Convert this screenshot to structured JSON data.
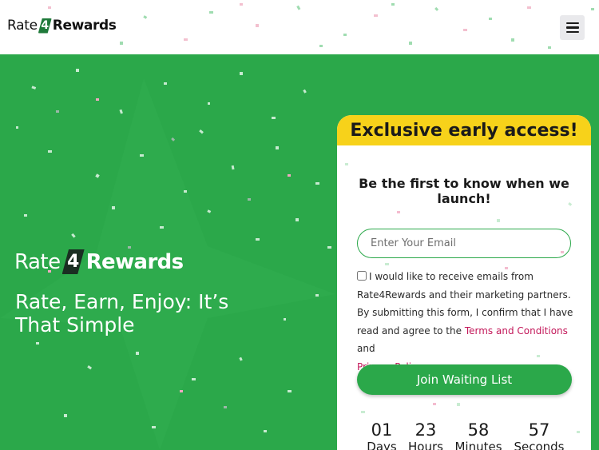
{
  "header": {
    "logo": {
      "word1": "Rate",
      "digit": "4",
      "word2": "Rewards"
    },
    "menu_icon": "hamburger-menu-icon"
  },
  "hero": {
    "logo": {
      "word1": "Rate",
      "digit": "4",
      "word2": "Rewards"
    },
    "tagline": "Rate, Earn, Enjoy: It’s That Simple"
  },
  "signup": {
    "banner": "Exclusive early access!",
    "subheading": "Be the first to know when we launch!",
    "email_placeholder": "Enter Your Email",
    "consent_text": "I would like to receive emails from Rate4Rewards and their marketing partners. By submitting this form, I confirm that I have read and agree to the",
    "terms_link": "Terms and Conditions",
    "and_text": "and",
    "privacy_link": "Privacy Policy",
    "period": ".",
    "button_label": "Join Waiting List",
    "countdown": [
      {
        "value": "01",
        "unit": "Days"
      },
      {
        "value": "23",
        "unit": "Hours"
      },
      {
        "value": "58",
        "unit": "Minutes"
      },
      {
        "value": "57",
        "unit": "Seconds"
      }
    ]
  },
  "colors": {
    "brand_green": "#2ba84a",
    "banner_yellow": "#f7d21a",
    "link_pink": "#c3185a"
  }
}
